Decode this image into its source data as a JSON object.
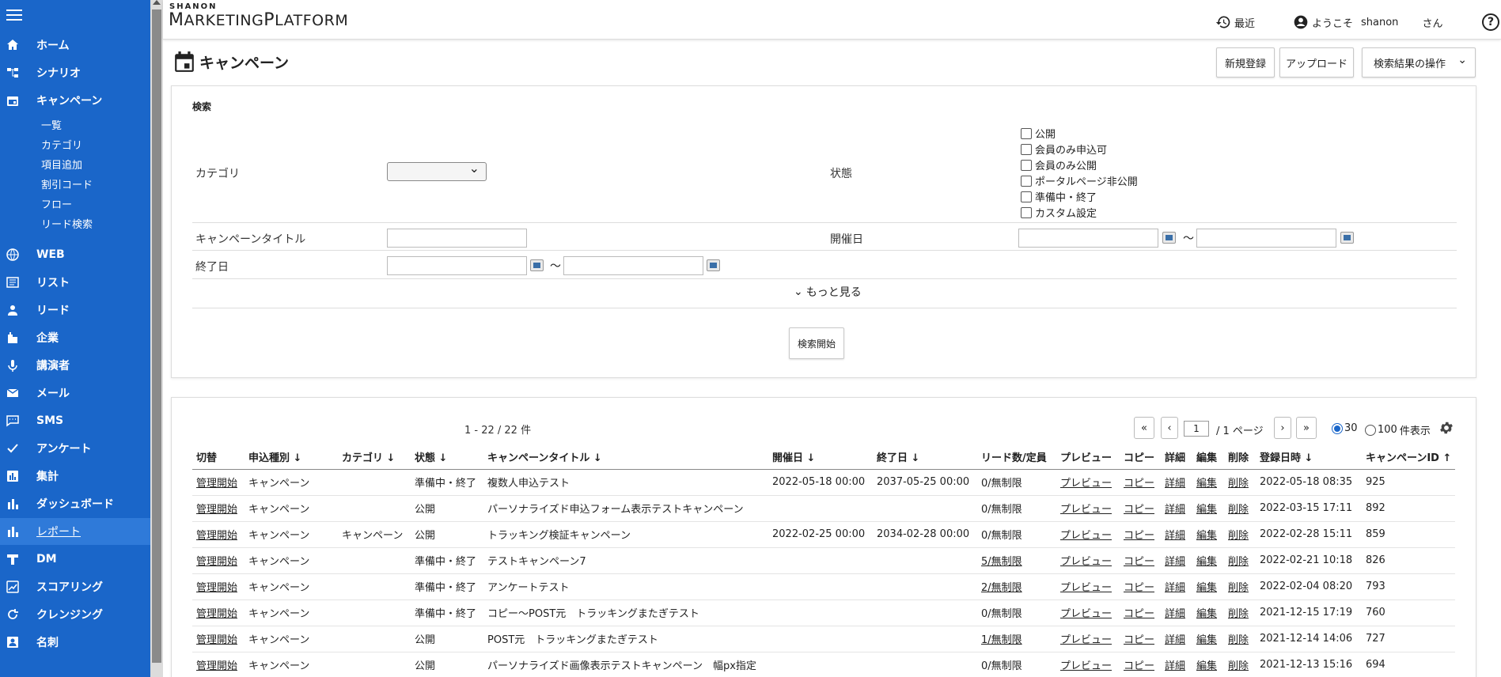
{
  "header": {
    "logo_top": "SHANON",
    "logo_main_1": "M",
    "logo_main_2": "ARKETING",
    "logo_main_3": "P",
    "logo_main_4": "LATFORM",
    "recent_label": "最近",
    "welcome_label": "ようこそ",
    "user_name": "shanon",
    "honorific": "さん",
    "help_label": "?"
  },
  "sidebar": {
    "items": [
      {
        "label": "ホーム",
        "icon": "home-icon"
      },
      {
        "label": "シナリオ",
        "icon": "scenario-icon"
      },
      {
        "label": "キャンペーン",
        "icon": "calendar-icon"
      },
      {
        "label": "WEB",
        "icon": "globe-icon"
      },
      {
        "label": "リスト",
        "icon": "list-icon"
      },
      {
        "label": "リード",
        "icon": "person-icon"
      },
      {
        "label": "企業",
        "icon": "building-icon"
      },
      {
        "label": "講演者",
        "icon": "mic-icon"
      },
      {
        "label": "メール",
        "icon": "mail-icon"
      },
      {
        "label": "SMS",
        "icon": "chat-icon"
      },
      {
        "label": "アンケート",
        "icon": "check-icon"
      },
      {
        "label": "集計",
        "icon": "tally-icon"
      },
      {
        "label": "ダッシュボード",
        "icon": "bar-chart-icon"
      },
      {
        "label": "レポート",
        "icon": "report-icon"
      },
      {
        "label": "DM",
        "icon": "mailbox-icon"
      },
      {
        "label": "スコアリング",
        "icon": "score-icon"
      },
      {
        "label": "クレンジング",
        "icon": "cleansing-icon"
      },
      {
        "label": "名刺",
        "icon": "card-icon"
      }
    ],
    "sub_items": [
      "一覧",
      "カテゴリ",
      "項目追加",
      "割引コード",
      "フロー",
      "リード検索"
    ]
  },
  "page": {
    "title": "キャンペーン",
    "new_button": "新規登録",
    "upload_button": "アップロード",
    "actions_select": "検索結果の操作"
  },
  "search": {
    "heading": "検索",
    "category_label": "カテゴリ",
    "status_label": "状態",
    "status_options": [
      "公開",
      "会員のみ申込可",
      "会員のみ公開",
      "ポータルページ非公開",
      "準備中・終了",
      "カスタム設定"
    ],
    "title_label": "キャンペーンタイトル",
    "date_label": "開催日",
    "end_label": "終了日",
    "tilde": "～",
    "more_label": "もっと見る",
    "submit_label": "検索開始"
  },
  "results": {
    "count": "1 - 22 / 22 件",
    "page_value": "1",
    "page_total": "/ 1 ページ",
    "first": "«",
    "prev": "‹",
    "next": "›",
    "last": "»",
    "per_page_30": "30",
    "per_page_100": "100",
    "per_page_suffix": "件表示",
    "columns": [
      "切替",
      "申込種別 ↓",
      "カテゴリ ↓",
      "状態 ↓",
      "キャンペーンタイトル ↓",
      "開催日 ↓",
      "終了日 ↓",
      "リード数/定員",
      "プレビュー",
      "コピー",
      "詳細",
      "編集",
      "削除",
      "登録日時 ↓",
      "キャンペーンID ↑"
    ],
    "rows": [
      [
        "管理開始",
        "キャンペーン",
        "",
        "準備中・終了",
        "複数人申込テスト",
        "2022-05-18 00:00",
        "2037-05-25 00:00",
        "0/無制限",
        "プレビュー",
        "コピー",
        "詳細",
        "編集",
        "削除",
        "2022-05-18 08:35",
        "925"
      ],
      [
        "管理開始",
        "キャンペーン",
        "",
        "公開",
        "パーソナライズド申込フォーム表示テストキャンペーン",
        "",
        "",
        "0/無制限",
        "プレビュー",
        "コピー",
        "詳細",
        "編集",
        "削除",
        "2022-03-15 17:11",
        "892"
      ],
      [
        "管理開始",
        "キャンペーン",
        "キャンペーン",
        "公開",
        "トラッキング検証キャンペーン",
        "2022-02-25 00:00",
        "2034-02-28 00:00",
        "0/無制限",
        "プレビュー",
        "コピー",
        "詳細",
        "編集",
        "削除",
        "2022-02-28 15:11",
        "859"
      ],
      [
        "管理開始",
        "キャンペーン",
        "",
        "準備中・終了",
        "テストキャンペーン7",
        "",
        "",
        "5/無制限",
        "プレビュー",
        "コピー",
        "詳細",
        "編集",
        "削除",
        "2022-02-21 10:18",
        "826"
      ],
      [
        "管理開始",
        "キャンペーン",
        "",
        "準備中・終了",
        "アンケートテスト",
        "",
        "",
        "2/無制限",
        "プレビュー",
        "コピー",
        "詳細",
        "編集",
        "削除",
        "2022-02-04 08:20",
        "793"
      ],
      [
        "管理開始",
        "キャンペーン",
        "",
        "準備中・終了",
        "コピー～POST元　トラッキングまたぎテスト",
        "",
        "",
        "0/無制限",
        "プレビュー",
        "コピー",
        "詳細",
        "編集",
        "削除",
        "2021-12-15 17:19",
        "760"
      ],
      [
        "管理開始",
        "キャンペーン",
        "",
        "公開",
        "POST元　トラッキングまたぎテスト",
        "",
        "",
        "1/無制限",
        "プレビュー",
        "コピー",
        "詳細",
        "編集",
        "削除",
        "2021-12-14 14:06",
        "727"
      ],
      [
        "管理開始",
        "キャンペーン",
        "",
        "公開",
        "パーソナライズド画像表示テストキャンペーン　幅px指定",
        "",
        "",
        "0/無制限",
        "プレビュー",
        "コピー",
        "詳細",
        "編集",
        "削除",
        "2021-12-13 15:16",
        "694"
      ]
    ]
  },
  "colors": {
    "sidebar_bg": "#1a66c9",
    "sidebar_active": "#2f7ad9",
    "radio_on": "#1a66c9"
  }
}
